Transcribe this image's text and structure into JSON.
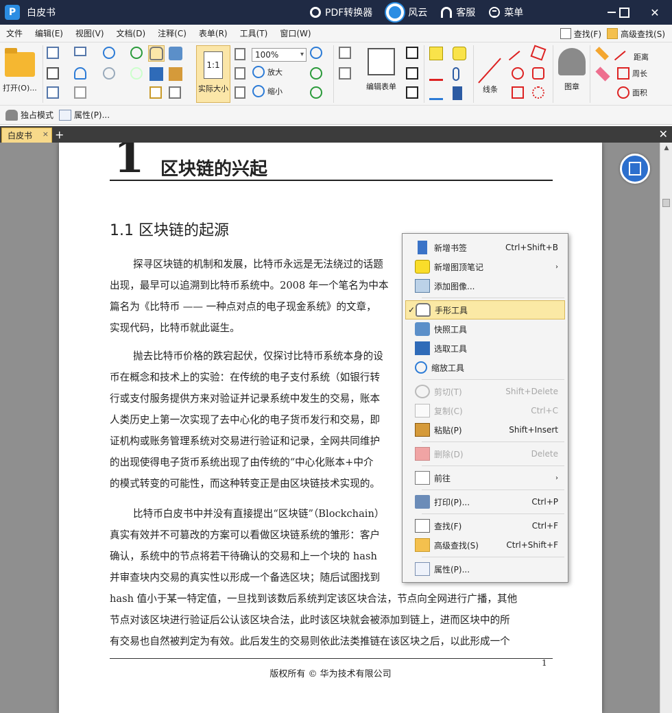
{
  "titlebar": {
    "app_title": "白皮书",
    "logo_letter": "P",
    "pdf_converter": "PDF转换器",
    "fengyun": "风云",
    "service": "客服",
    "menu": "菜单",
    "close": "✕"
  },
  "menubar": {
    "items": [
      "文件",
      "编辑(E)",
      "视图(V)",
      "文档(D)",
      "注释(C)",
      "表单(R)",
      "工具(T)",
      "窗口(W)"
    ],
    "find": "查找(F)",
    "advanced_find": "高级查找(S)"
  },
  "toolbar": {
    "open": "打开(O)...",
    "zoom_value": "100%",
    "zoom_in": "放大",
    "zoom_out": "缩小",
    "actual_size": "实际大小",
    "actual_size_icon": "1:1",
    "edit_form": "编辑表单",
    "lines": "线条",
    "stamp": "图章",
    "distance": "距离",
    "perimeter": "周长",
    "area": "面积"
  },
  "quickbar": {
    "exclusive_mode": "独占模式",
    "properties": "属性(P)..."
  },
  "tabs": {
    "doc_tab": "白皮书",
    "tab_close": "×",
    "add": "+",
    "close_all": "✕"
  },
  "document": {
    "chapter_num": "1",
    "chapter_title": "区块链的兴起",
    "section_title": "1.1 区块链的起源",
    "para1": [
      "探寻区块链的机制和发展，比特币永远是无法绕过的话题",
      "出现，最早可以追溯到比特币系统中。2008 年一个笔名为中本",
      "篇名为《比特币 —— 一种点对点的电子现金系统》的文章，",
      "实现代码，比特币就此诞生。"
    ],
    "para2": [
      "抛去比特币价格的跌宕起伏，仅探讨比特币系统本身的设",
      "币在概念和技术上的实验：在传统的电子支付系统（如银行转",
      "行或支付服务提供方来对验证并记录系统中发生的交易，账本",
      "人类历史上第一次实现了去中心化的电子货币发行和交易，即",
      "证机构或账务管理系统对交易进行验证和记录，全网共同维护",
      "的出现使得电子货币系统出现了由传统的“中心化账本+中介",
      "的模式转变的可能性，而这种转变正是由区块链技术实现的。"
    ],
    "para3": [
      "比特币白皮书中并没有直接提出“区块链”（Blockchain）",
      "真实有效并不可篡改的方案可以看做区块链系统的雏形：客户",
      "确认，系统中的节点将若干待确认的交易和上一个块的 hash",
      "并审查块内交易的真实性以形成一个备选区块；随后试图找到",
      "hash 值小于某一特定值，一旦找到该数后系统判定该区块合法，节点向全网进行广播，其他",
      "节点对该区块进行验证后公认该区块合法，此时该区块就会被添加到链上，进而区块中的所",
      "有交易也自然被判定为有效。此后发生的交易则依此法类推链在该区块之后，以此形成一个"
    ],
    "page_number": "1",
    "footer": "版权所有 © 华为技术有限公司"
  },
  "context_menu": {
    "items": [
      {
        "label": "新增书签",
        "shortcut": "Ctrl+Shift+B",
        "icon": "bookmark-icon"
      },
      {
        "label": "新增图顶笔记",
        "shortcut": "",
        "icon": "note-icon"
      },
      {
        "label": "添加图像...",
        "shortcut": "",
        "icon": "add-image-icon"
      },
      {
        "label": "手形工具",
        "shortcut": "",
        "icon": "hand-icon"
      },
      {
        "label": "快照工具",
        "shortcut": "",
        "icon": "camera-icon"
      },
      {
        "label": "选取工具",
        "shortcut": "",
        "icon": "select-text-icon"
      },
      {
        "label": "缩放工具",
        "shortcut": "",
        "icon": "zoom-icon"
      },
      {
        "label": "剪切(T)",
        "shortcut": "Shift+Delete",
        "icon": "scissors-icon"
      },
      {
        "label": "复制(C)",
        "shortcut": "Ctrl+C",
        "icon": "copy-icon"
      },
      {
        "label": "粘贴(P)",
        "shortcut": "Shift+Insert",
        "icon": "paste-icon"
      },
      {
        "label": "删除(D)",
        "shortcut": "Delete",
        "icon": "trash-icon"
      },
      {
        "label": "前往",
        "shortcut": "",
        "icon": "goto-icon"
      },
      {
        "label": "打印(P)...",
        "shortcut": "Ctrl+P",
        "icon": "printer-icon"
      },
      {
        "label": "查找(F)",
        "shortcut": "Ctrl+F",
        "icon": "find-icon"
      },
      {
        "label": "高级查找(S)",
        "shortcut": "Ctrl+Shift+F",
        "icon": "advanced-find-icon"
      },
      {
        "label": "属性(P)...",
        "shortcut": "",
        "icon": "properties-icon"
      }
    ],
    "check_mark": "✓",
    "submenu_arrow": "›"
  },
  "colors": {
    "titlebar_bg": "#1f2a44",
    "accent_blue": "#2b8de3",
    "tab_bg": "#f7d98a",
    "highlight": "#fbe9a5"
  }
}
